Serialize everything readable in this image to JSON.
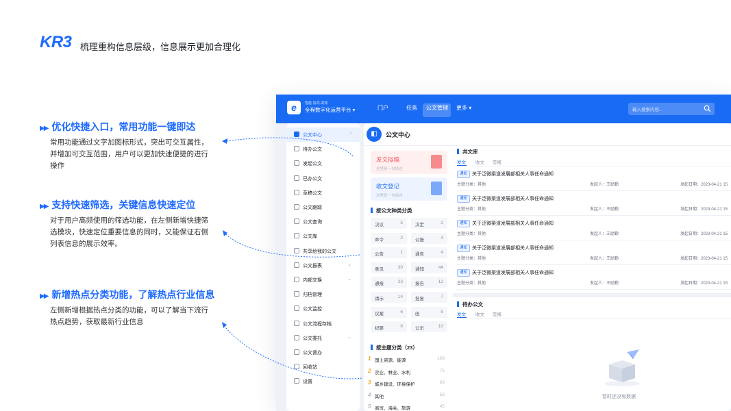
{
  "header": {
    "logo": "KR3",
    "subtitle": "梳理重构信息层级，信息展示更加合理化"
  },
  "features": [
    {
      "title": "优化快捷入口，常用功能一键即达",
      "desc": "常用功能通过文字加图标形式，突出可交互属性，并增加可交互范围，用户可以更加快速便捷的进行操作"
    },
    {
      "title": "支持快速筛选，关键信息快速定位",
      "desc": "对于用户高频使用的筛选功能，在左侧新增快捷筛选模块，快速定位重要信息的同时，又能保证右侧列表信息的展示效率。"
    },
    {
      "title": "新增热点分类功能，了解热点行业信息",
      "desc": "左侧新增根据热点分类的功能，可以了解当下流行热点趋势，获取最新行业信息"
    }
  ],
  "app": {
    "slogan": "智能·协同·高效",
    "name": "全程数字化运营平台",
    "nav": [
      "门户",
      "任务",
      "公文管理",
      "更多"
    ],
    "search_placeholder": "输入搜索内容...",
    "sidebar": [
      {
        "label": "公文中心",
        "chev": "›"
      },
      {
        "label": "待办公文"
      },
      {
        "label": "发起公文"
      },
      {
        "label": "已办公文"
      },
      {
        "label": "草稿公文"
      },
      {
        "label": "公文跟踪"
      },
      {
        "label": "公文查询"
      },
      {
        "label": "公文库"
      },
      {
        "label": "共享给我的公文"
      },
      {
        "label": "公文报表",
        "chev": "⌄"
      },
      {
        "label": "内部交换",
        "chev": "⌄"
      },
      {
        "label": "归档管理"
      },
      {
        "label": "公文监控"
      },
      {
        "label": "公文流程存档"
      },
      {
        "label": "公文委托",
        "chev": "⌄"
      },
      {
        "label": "公文督办"
      },
      {
        "label": "回收站"
      },
      {
        "label": "设置"
      }
    ],
    "main_title": "公文中心",
    "cards": [
      {
        "title": "发文拟稿",
        "sub": "这里是一句描述"
      },
      {
        "title": "收文登记",
        "sub": "这里是一句描述"
      }
    ],
    "category_title": "按公文种类分类",
    "categories": [
      {
        "name": "决议",
        "count": "5"
      },
      {
        "name": "决定",
        "count": "2"
      },
      {
        "name": "命令",
        "count": "2"
      },
      {
        "name": "公报",
        "count": "4"
      },
      {
        "name": "公告",
        "count": "1"
      },
      {
        "name": "通告",
        "count": "4"
      },
      {
        "name": "意见",
        "count": "30"
      },
      {
        "name": "通知",
        "count": "44"
      },
      {
        "name": "通报",
        "count": "23"
      },
      {
        "name": "报告",
        "count": "12"
      },
      {
        "name": "请示",
        "count": "14"
      },
      {
        "name": "批复",
        "count": "7"
      },
      {
        "name": "议案",
        "count": "6"
      },
      {
        "name": "函",
        "count": "5"
      },
      {
        "name": "纪要",
        "count": "8"
      },
      {
        "name": "公示",
        "count": "10"
      }
    ],
    "topic_title": "按主题分类（23）",
    "topics": [
      {
        "rank": "1",
        "name": "国土资源、能源",
        "count": "109"
      },
      {
        "rank": "2",
        "name": "农业、林业、水利",
        "count": "75"
      },
      {
        "rank": "3",
        "name": "城乡建设、环境保护",
        "count": "63"
      },
      {
        "rank": "4",
        "name": "其他",
        "count": "53"
      },
      {
        "rank": "5",
        "name": "商贸、海关、旅游",
        "count": "45"
      }
    ],
    "library": {
      "title": "共文库",
      "tabs": [
        "发文",
        "收文",
        "签报"
      ],
      "docs": [
        {
          "badge": "通知",
          "title": "关于泛微渠道发展部相关人事任命通知",
          "cat": "主题分类：其他",
          "author": "发起人：王励勤",
          "date": "发起日期：2023-04-21 15"
        },
        {
          "badge": "通知",
          "title": "关于泛微渠道发展部相关人事任命通知",
          "cat": "主题分类：其他",
          "author": "发起人：王励勤",
          "date": "发起日期：2023-04-21 15"
        },
        {
          "badge": "通知",
          "title": "关于泛微渠道发展部相关人事任命通知",
          "cat": "主题分类：其他",
          "author": "发起人：王励勤",
          "date": "发起日期：2023-04-21 15"
        },
        {
          "badge": "通知",
          "title": "关于泛微渠道发展部相关人事任命通知",
          "cat": "主题分类：其他",
          "author": "发起人：王励勤",
          "date": "发起日期：2023-04-21 15"
        },
        {
          "badge": "通知",
          "title": "关于泛微渠道发展部相关人事任命通知",
          "cat": "主题分类：其他",
          "author": "发起人：王励勤",
          "date": "发起日期：2023-04-21 15"
        }
      ]
    },
    "todo": {
      "title": "待办公文",
      "tabs": [
        "发文",
        "收文",
        "签报"
      ],
      "empty": "暂时还没有数据"
    }
  },
  "colors": {
    "brand": "#1a6bf4",
    "accent_red": "#f0555a"
  }
}
